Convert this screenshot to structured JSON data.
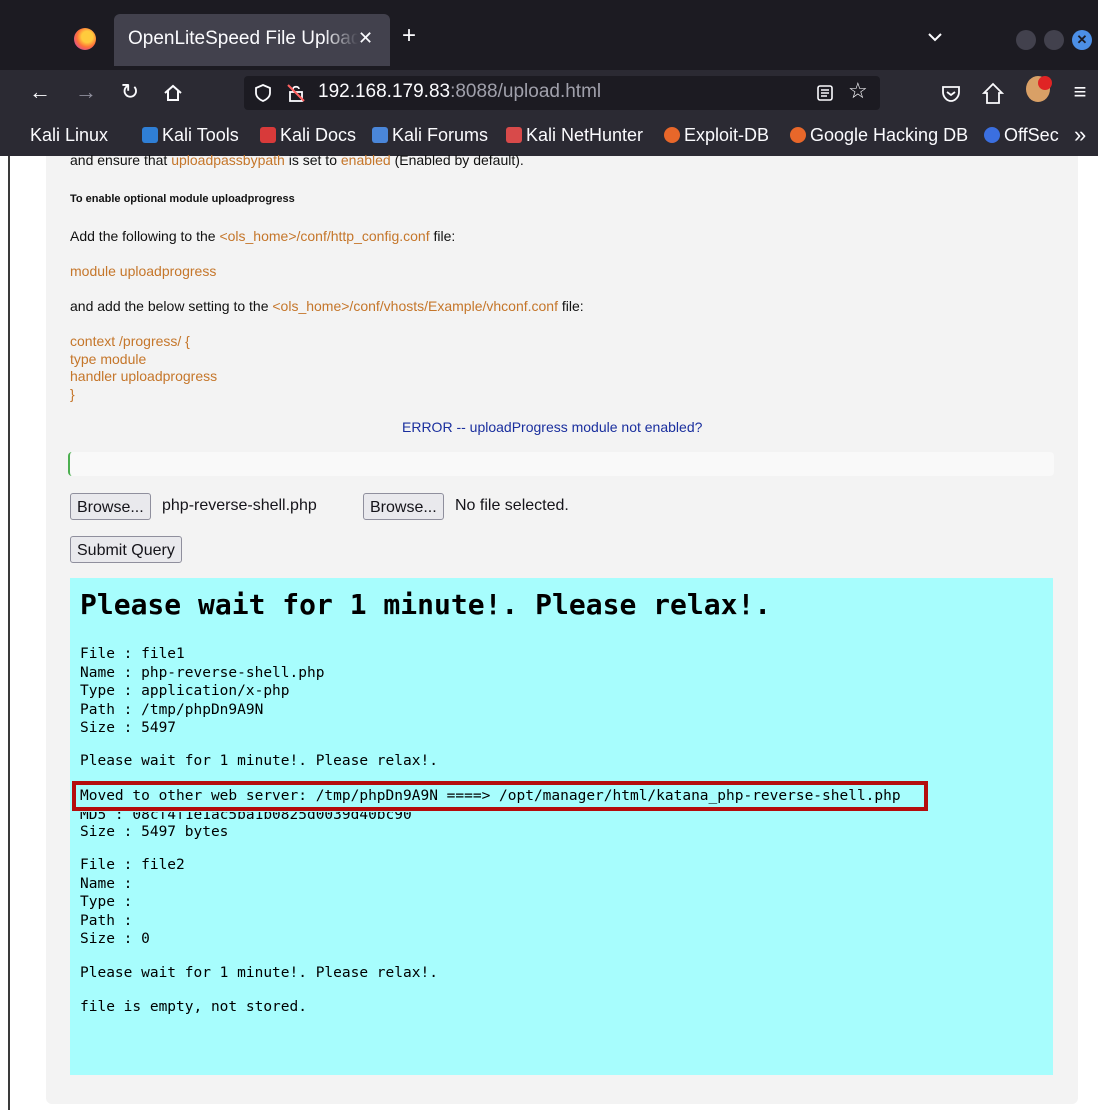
{
  "browser": {
    "tab_title": "OpenLiteSpeed File Upload T",
    "tab_close": "✕",
    "new_tab": "+",
    "url_host": "192.168.179.83",
    "url_rest": ":8088/upload.html",
    "bookmarks": [
      {
        "label": "Kali Linux",
        "color": "#3b82d6"
      },
      {
        "label": "Kali Tools",
        "color": "#2f7fd6"
      },
      {
        "label": "Kali Docs",
        "color": "#d83a3a"
      },
      {
        "label": "Kali Forums",
        "color": "#4a86d9"
      },
      {
        "label": "Kali NetHunter",
        "color": "#d84a4a"
      },
      {
        "label": "Exploit-DB",
        "color": "#e8672a"
      },
      {
        "label": "Google Hacking DB",
        "color": "#e8672a"
      },
      {
        "label": "OffSec",
        "color": "#3b6fe0"
      }
    ],
    "overflow": "»"
  },
  "instructions": {
    "line1_prefix": "and ensure that ",
    "line1_setting": "uploadpassbypath",
    "line1_mid": " is set to ",
    "line1_value": "enabled",
    "line1_suffix": " (Enabled by default).",
    "heading": "To enable optional module uploadprogress",
    "line2_prefix": "Add the following to the ",
    "line2_path": "<ols_home>/conf/http_config.conf",
    "line2_suffix": " file:",
    "module_line": "module uploadprogress",
    "line3_prefix": "and add the below setting to the ",
    "line3_path": "<ols_home>/conf/vhosts/Example/vhconf.conf",
    "line3_suffix": " file:",
    "context_lines": [
      "context /progress/ {",
      "type module",
      "handler uploadprogress",
      "}"
    ],
    "error": "ERROR -- uploadProgress module not enabled?"
  },
  "form": {
    "browse_label": "Browse...",
    "file1_name": "php-reverse-shell.php",
    "file2_name": "No file selected.",
    "submit_label": "Submit Query"
  },
  "result": {
    "heading": "Please wait for 1 minute!. Please relax!.",
    "file1_block": "File : file1\nName : php-reverse-shell.php\nType : application/x-php\nPath : /tmp/phpDn9A9N\nSize : 5497",
    "wait1": "Please wait for 1 minute!. Please relax!.",
    "moved": "Moved to other web server: /tmp/phpDn9A9N ====> /opt/manager/html/katana_php-reverse-shell.php",
    "md5_partial": "MD5 : 08cf4f1e1ac5ba1b0825d0039d40bc90",
    "size_bytes": "Size : 5497 bytes",
    "file2_block": "File : file2\nName :\nType :\nPath :\nSize : 0",
    "wait2": "Please wait for 1 minute!. Please relax!.",
    "empty": "file is empty, not stored."
  }
}
